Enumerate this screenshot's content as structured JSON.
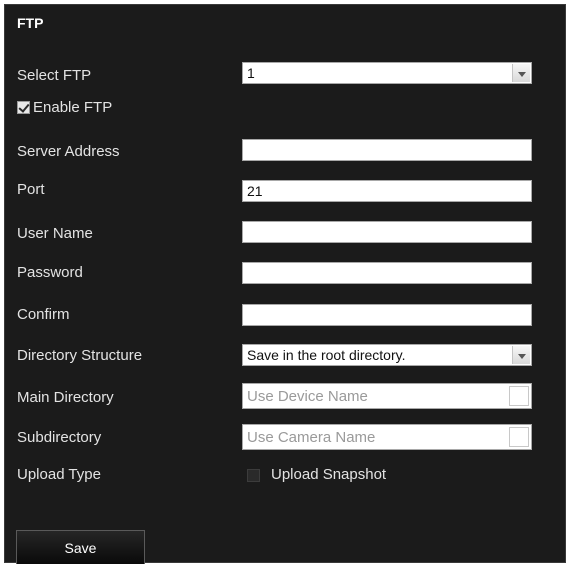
{
  "section": {
    "title": "FTP"
  },
  "select_ftp": {
    "label": "Select FTP",
    "value": "1"
  },
  "enable_ftp": {
    "label": "Enable FTP",
    "checked": true
  },
  "server_address": {
    "label": "Server Address",
    "value": ""
  },
  "port": {
    "label": "Port",
    "value": "21"
  },
  "user_name": {
    "label": "User Name",
    "value": ""
  },
  "password": {
    "label": "Password",
    "value": ""
  },
  "confirm": {
    "label": "Confirm",
    "value": ""
  },
  "directory_structure": {
    "label": "Directory Structure",
    "value": "Save in the root directory."
  },
  "main_directory": {
    "label": "Main Directory",
    "value": "Use Device Name"
  },
  "subdirectory": {
    "label": "Subdirectory",
    "value": "Use Camera Name"
  },
  "upload_type": {
    "label": "Upload Type",
    "option_label": "Upload Snapshot",
    "checked": false
  },
  "actions": {
    "save_label": "Save"
  },
  "icons": {
    "dropdown": "chevron-down-icon",
    "checkbox": "checkbox-icon"
  }
}
